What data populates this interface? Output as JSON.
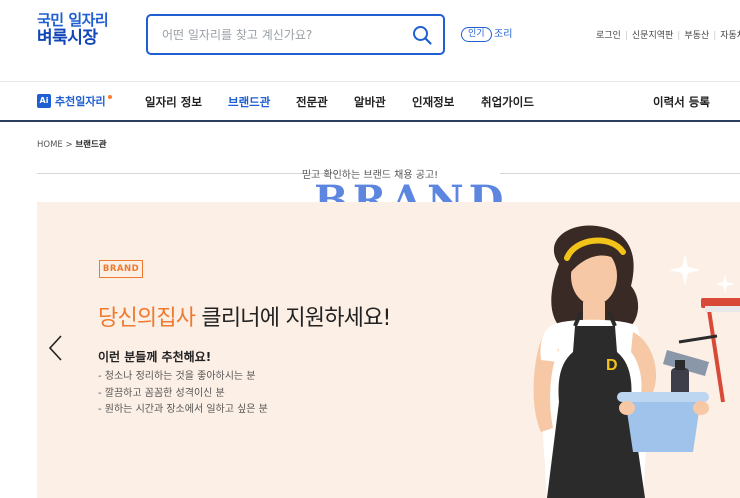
{
  "header": {
    "logo_line1": "국민 일자리",
    "logo_line2": "벼룩시장",
    "search_placeholder": "어떤 일자리를 찾고 계신가요?",
    "popular_badge": "인기",
    "popular_keyword": "조리",
    "util_links": [
      "로그인",
      "신문지역판",
      "부동산",
      "자동차"
    ]
  },
  "nav": {
    "ai_icon_text": "Ai",
    "ai_label": "추천일자리",
    "items": [
      "일자리 정보",
      "브랜드관",
      "전문관",
      "알바관",
      "인재정보",
      "취업가이드"
    ],
    "active": "브랜드관",
    "resume": "이력서 등록"
  },
  "breadcrumb": {
    "home": "HOME",
    "separator": ">",
    "current": "브랜드관"
  },
  "brand_section": {
    "subtitle": "믿고 확인하는 브랜드 채용 공고!",
    "title": "BRAND."
  },
  "banner": {
    "badge": "BRAND",
    "headline_orange": "당신의집사",
    "headline_dark": " 클리너에 지원하세요!",
    "recommend_title": "이런 분들께 추천해요!",
    "bullets": [
      "- 청소나 정리하는 것을 좋아하시는 분",
      "- 깔끔하고 꼼꼼한 성격이신 분",
      "- 원하는 시간과 장소에서 일하고 싶은 분"
    ],
    "apron_letter": "D"
  },
  "colors": {
    "primary": "#1f5fd1",
    "brand_title": "#5d86e0",
    "accent_orange": "#ef7a2f",
    "banner_bg": "#fcefe6"
  }
}
